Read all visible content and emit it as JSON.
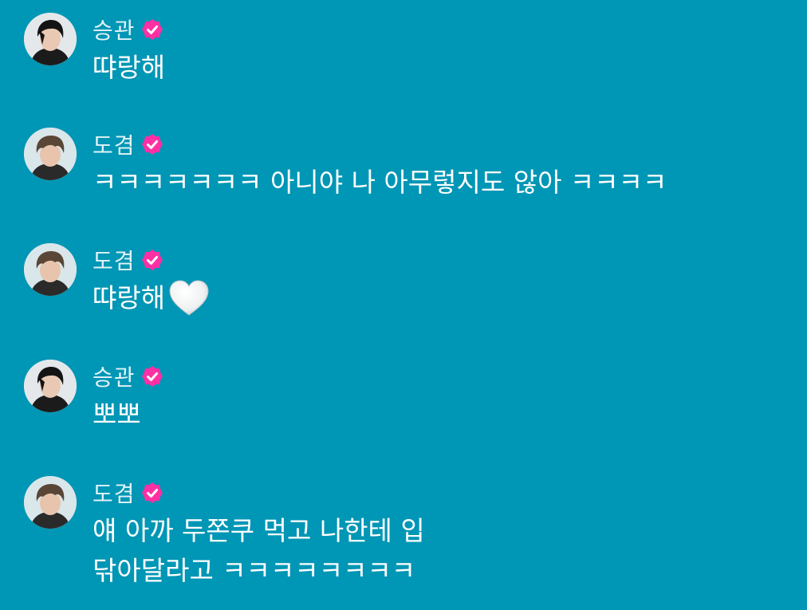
{
  "colors": {
    "background": "#0096b5",
    "badge": "#ff2fa4",
    "name_text": "#e3f3f7",
    "message_text": "#ffffff"
  },
  "messages": [
    {
      "sender": "승관",
      "verified_icon": "verified-badge-icon",
      "avatar_icon": "avatar-photo-icon",
      "text": "땨랑해",
      "emoji": ""
    },
    {
      "sender": "도겸",
      "verified_icon": "verified-badge-icon",
      "avatar_icon": "avatar-photo-icon",
      "text": "ㅋㅋㅋㅋㅋㅋㅋ 아니야 나 아무렇지도 않아 ㅋㅋㅋㅋ",
      "emoji": ""
    },
    {
      "sender": "도겸",
      "verified_icon": "verified-badge-icon",
      "avatar_icon": "avatar-photo-icon",
      "text": "땨랑해",
      "emoji": "white-heart-icon"
    },
    {
      "sender": "승관",
      "verified_icon": "verified-badge-icon",
      "avatar_icon": "avatar-photo-icon",
      "text": "뽀뽀",
      "emoji": ""
    },
    {
      "sender": "도겸",
      "verified_icon": "verified-badge-icon",
      "avatar_icon": "avatar-photo-icon",
      "text": "얘 아까 두쫀쿠 먹고 나한테 입\n닦아달라고 ㅋㅋㅋㅋㅋㅋㅋㅋ",
      "emoji": ""
    }
  ]
}
